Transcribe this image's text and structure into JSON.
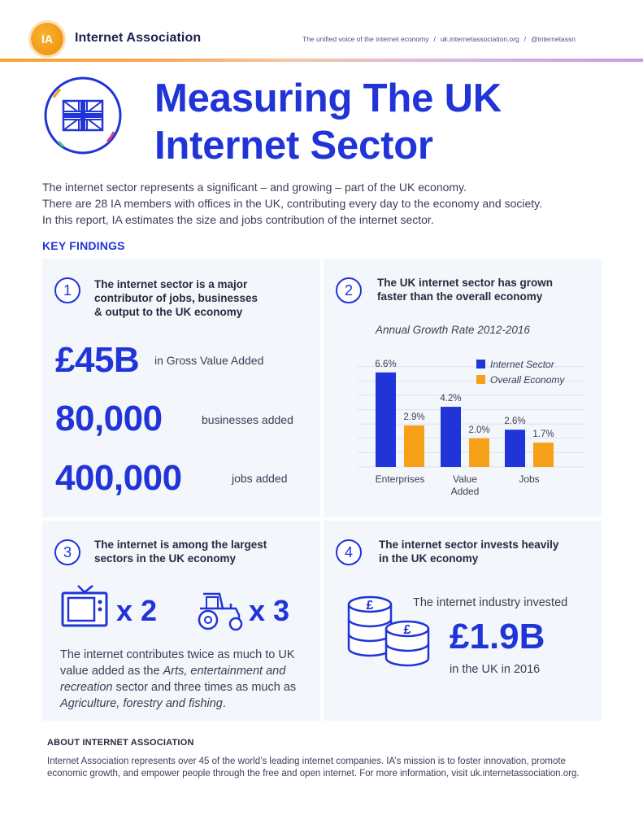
{
  "header": {
    "logo_initials": "IA",
    "brand_name": "Internet Association",
    "tagline": "The unified voice of the internet economy",
    "website": "uk.internetassociation.org",
    "twitter": "@internetassn"
  },
  "hero": {
    "title_line1": "Measuring The UK",
    "title_line2": "Internet Sector",
    "intro_lines": [
      "The internet sector represents a significant – and growing – part of the UK economy.",
      "There are 28 IA members with offices in the UK, contributing every day to the economy and society.",
      "In this report, IA estimates the size and jobs contribution of the internet sector."
    ]
  },
  "key_findings_label": "KEY FINDINGS",
  "panel1": {
    "number": "1",
    "title_lines": [
      "The internet sector is a major",
      "contributor of jobs, businesses",
      "& output to the UK economy"
    ],
    "stats": [
      {
        "value": "£45B",
        "caption": "in Gross Value Added"
      },
      {
        "value": "80,000",
        "caption": "businesses added"
      },
      {
        "value": "400,000",
        "caption": "jobs added"
      }
    ]
  },
  "panel2": {
    "number": "2",
    "title_lines": [
      "The UK internet sector has grown",
      "faster than the overall economy"
    ]
  },
  "chart_data": {
    "type": "bar",
    "title": "Annual Growth Rate 2012-2016",
    "categories": [
      "Enterprises",
      "Value Added",
      "Jobs"
    ],
    "series": [
      {
        "name": "Internet Sector",
        "values": [
          6.6,
          4.2,
          2.6
        ],
        "labels": [
          "6.6%",
          "4.2%",
          "2.6%"
        ],
        "color": "#2034d8"
      },
      {
        "name": "Overall Economy",
        "values": [
          2.9,
          2.0,
          1.7
        ],
        "labels": [
          "2.9%",
          "2.0%",
          "1.7%"
        ],
        "color": "#f6a118"
      }
    ],
    "ylim": [
      0,
      7.5
    ],
    "grid": true,
    "legend": "top-right"
  },
  "panel3": {
    "number": "3",
    "title_lines": [
      "The internet is among the largest",
      "sectors in the UK economy"
    ],
    "tv_multiplier": "x 2",
    "tractor_multiplier": "x 3",
    "body": {
      "t1": "The internet contributes twice as much to UK value added as the ",
      "i1": "Arts, entertainment and recreation",
      "t2": " sector and three times as much as ",
      "i2": "Agriculture, forestry and fishing",
      "t3": "."
    }
  },
  "panel4": {
    "number": "4",
    "title_lines": [
      "The internet sector invests heavily",
      "in the UK economy"
    ],
    "invested_label": "The internet industry invested",
    "amount": "£1.9B",
    "year_label": "in the UK in 2016"
  },
  "about": {
    "title": "ABOUT INTERNET ASSOCIATION",
    "text": "Internet Association represents over 45 of the world’s leading internet companies. IA’s mission is to foster innovation, promote economic growth, and empower people through the free and open internet. For more information, visit uk.internetassociation.org."
  },
  "colors": {
    "primary_blue": "#2034d8",
    "orange": "#f6a118",
    "panel_bg": "#f3f6fb"
  }
}
